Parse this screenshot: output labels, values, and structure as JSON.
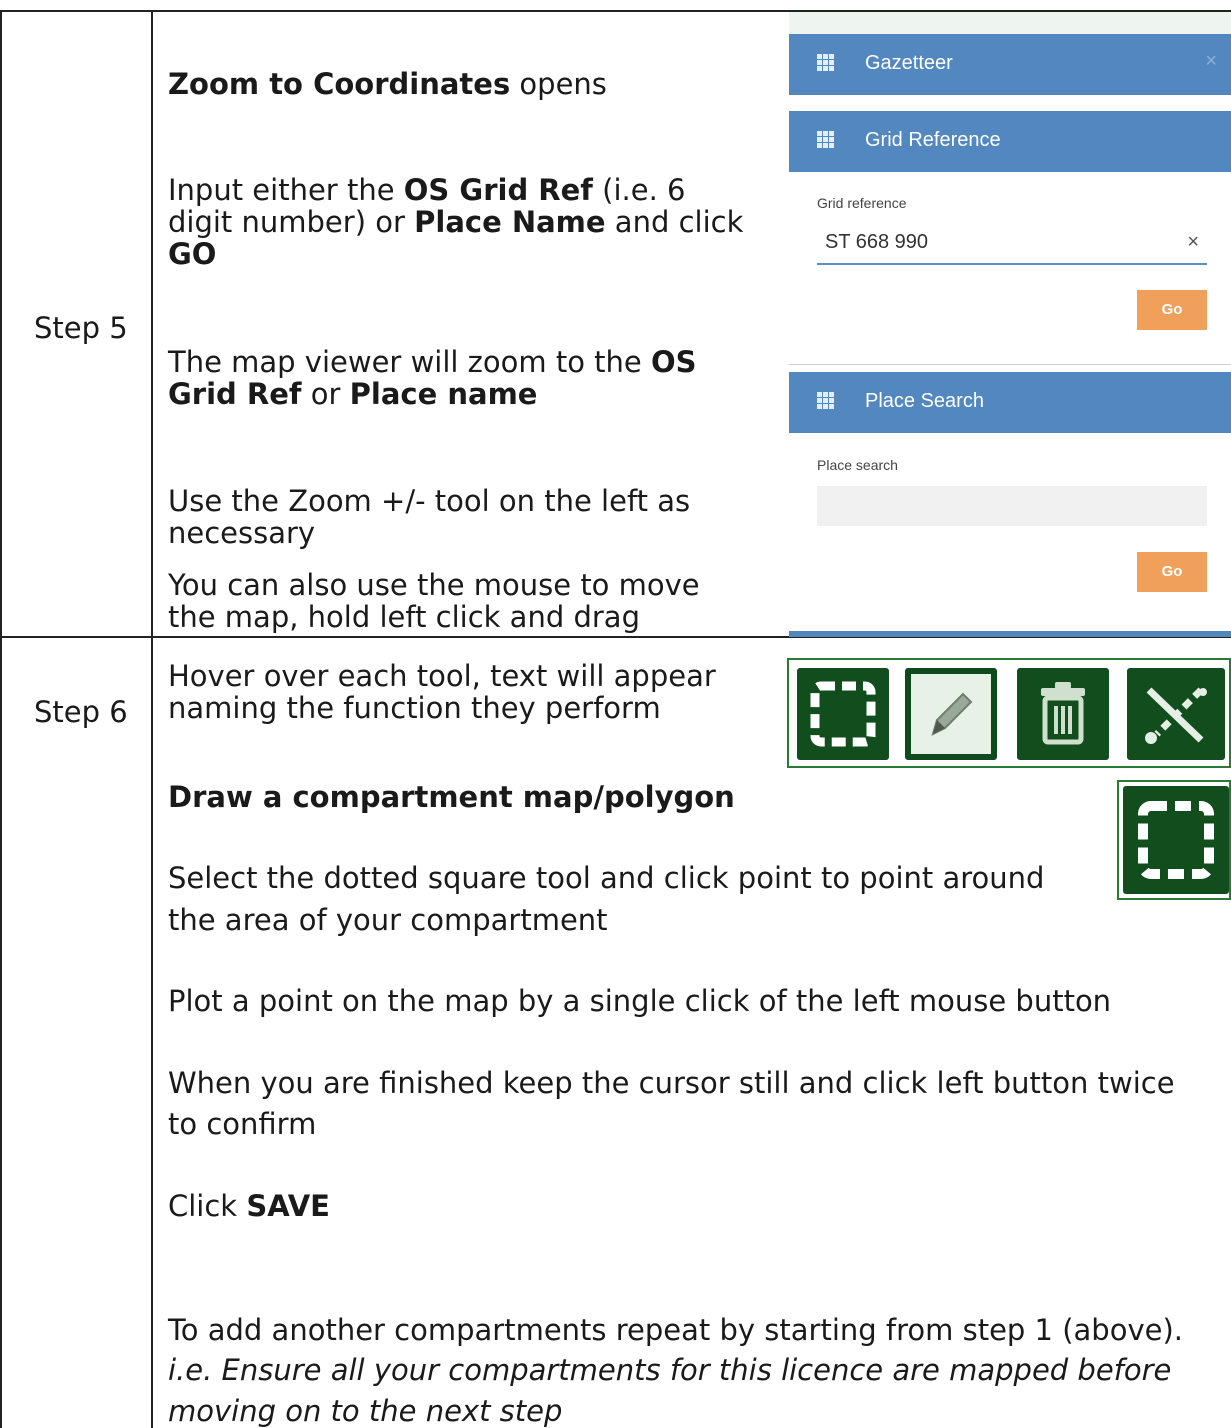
{
  "step5": {
    "label": "Step 5",
    "line1_bold": "Zoom to Coordinates",
    "line1_rest": " opens",
    "p2_a": "Input either the ",
    "p2_b": "OS Grid Ref",
    "p2_c": " (i.e. 6",
    "p2_d": "digit number) or ",
    "p2_e": "Place Name",
    "p2_f": " and click",
    "p2_g": "GO",
    "p3_a": "The map viewer will zoom to the ",
    "p3_b": "OS",
    "p3_c": "Grid Ref",
    "p3_d": " or ",
    "p3_e": "Place name",
    "p4_a": "Use the Zoom +/- tool on the left as",
    "p4_b": "necessary",
    "p5_a": "You can also use the mouse to move",
    "p5_b": "the map, hold left click and drag"
  },
  "gazetteer": {
    "title": "Gazetteer",
    "close": "×",
    "grid_header": "Grid Reference",
    "grid_label": "Grid reference",
    "grid_value": "ST 668 990",
    "grid_clear": "×",
    "go": "Go",
    "place_header": "Place Search",
    "place_label": "Place search",
    "place_value": "",
    "go2": "Go"
  },
  "step6": {
    "label": "Step 6",
    "hover_a": "Hover over each tool, text will appear",
    "hover_b": "naming the function they perform",
    "draw_title": "Draw a compartment map/polygon",
    "select_a": "Select the dotted square tool and click point to point around",
    "select_b": "the area of your compartment",
    "plot": "Plot a point on the map by a single click of the left mouse button",
    "finish_a": "When you are finished keep the cursor still and click left button twice",
    "finish_b": "to confirm",
    "click_a": "Click ",
    "click_b": "SAVE",
    "repeat": "To add another compartments repeat by starting from step 1 (above).",
    "note_a": "i.e. Ensure all your compartments for this licence are mapped before",
    "note_b": "moving on to the next step"
  },
  "toolbar": {
    "icons": [
      "draw-polygon-icon",
      "edit-pencil-icon",
      "delete-trash-icon",
      "scissors-split-icon"
    ]
  },
  "colors": {
    "panel_header": "#5288bf",
    "go_button": "#f0a05a",
    "tool_green": "#114d1d"
  }
}
